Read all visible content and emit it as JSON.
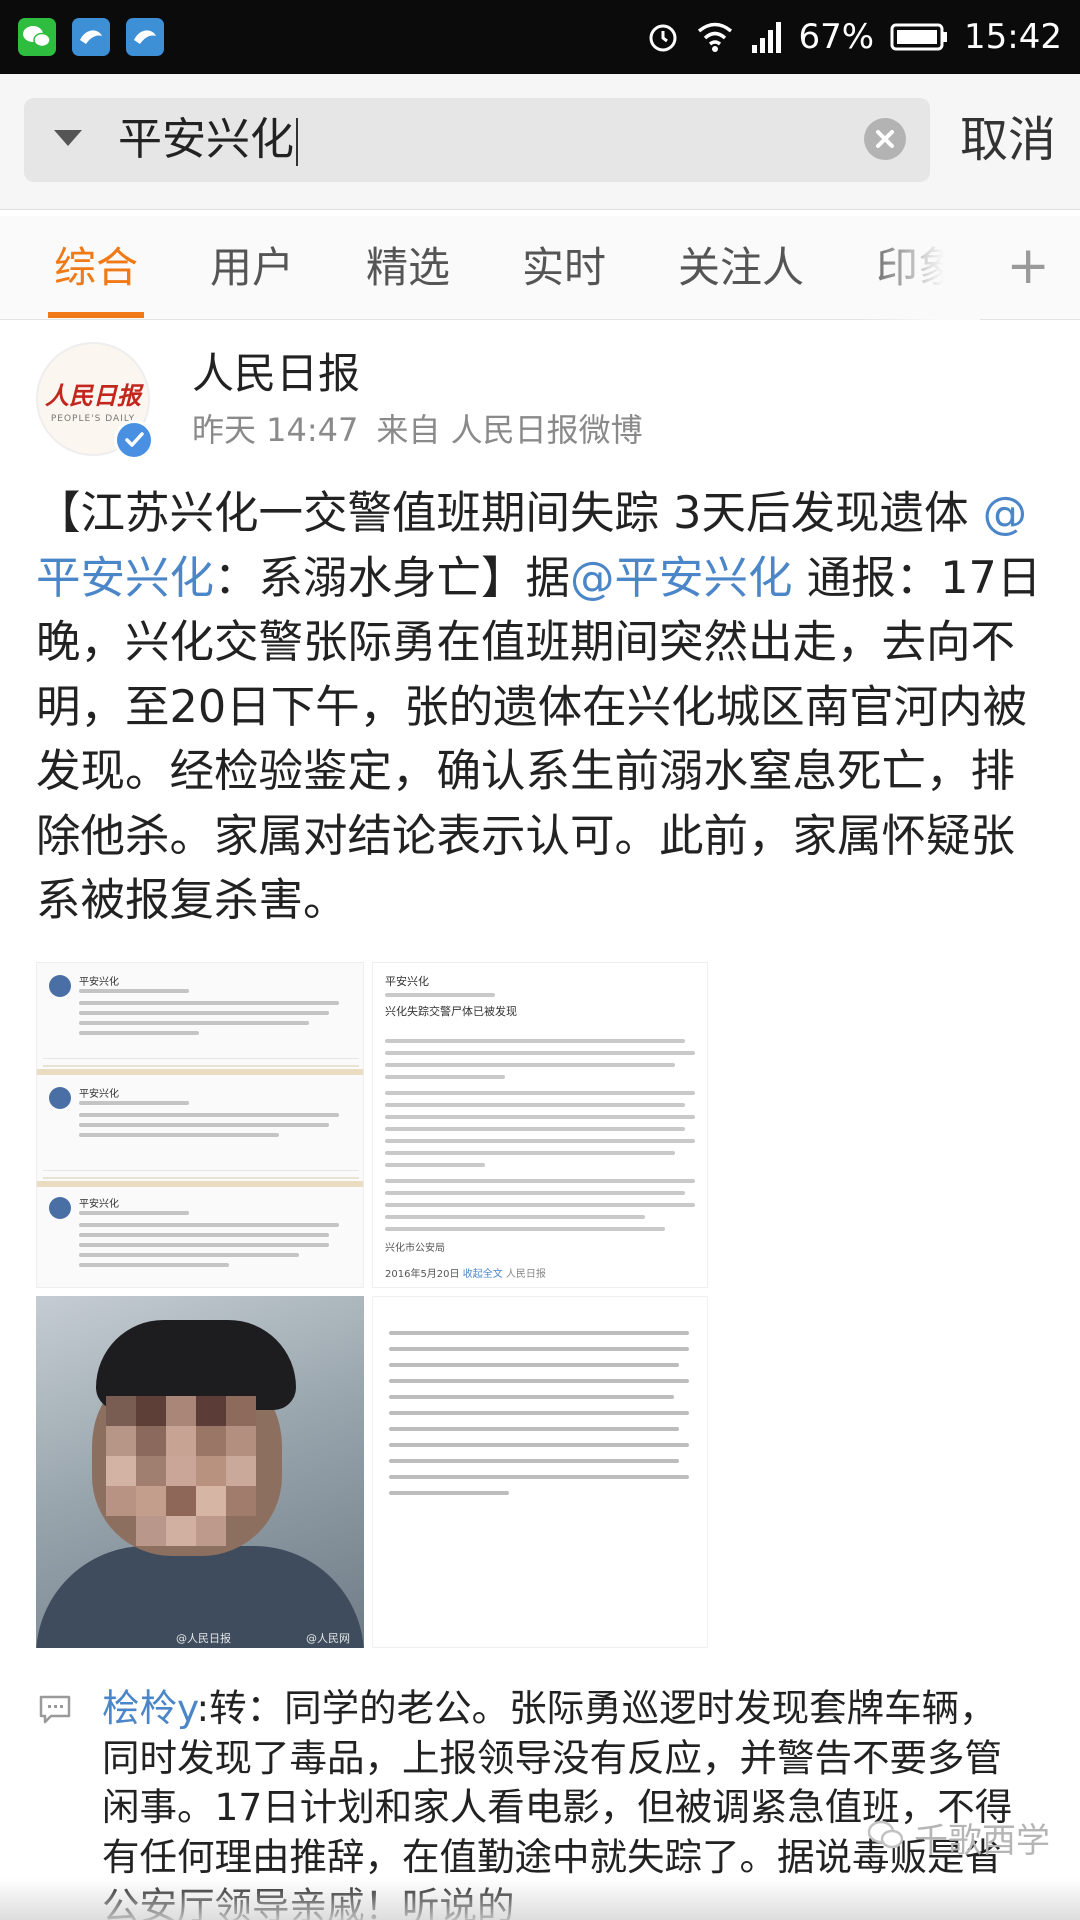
{
  "status_bar": {
    "battery": "67%",
    "time": "15:42",
    "app_icons": [
      "wechat-icon",
      "bird-icon",
      "bird-icon"
    ],
    "system_icons": [
      "alarm-icon",
      "wifi-icon",
      "signal-icon",
      "battery-icon"
    ]
  },
  "search": {
    "query": "平安兴化",
    "cancel_label": "取消"
  },
  "tabs": {
    "items": [
      "综合",
      "用户",
      "精选",
      "实时",
      "关注人",
      "印象"
    ],
    "active": "综合",
    "add_label": "+"
  },
  "post": {
    "author": "人民日报",
    "time": "昨天 14:47",
    "source": "来自 人民日报微博",
    "avatar_text": "人民日报",
    "avatar_subtext": "PEOPLE'S DAILY",
    "text_parts": {
      "part1": "【江苏兴化一交警值班期间失踪 3天后发现遗体 ",
      "mention1": "@平安兴化",
      "part2": "：系溺水身亡】据",
      "mention2": "@平安兴化",
      "part3": " 通报：17日晚，兴化交警张际勇在值班期间突然出走，去向不明，至20日下午，张的遗体在兴化城区南官河内被发现。经检验鉴定，确认系生前溺水窒息死亡，排除他杀。家属对结论表示认可。此前，家属怀疑张系被报复杀害。"
    },
    "images": {
      "a_names": [
        "平安兴化",
        "平安兴化",
        "平安兴化"
      ],
      "b_title": "平安兴化",
      "b_heading": "兴化失踪交警尸体已被发现",
      "b_sign": "兴化市公安局",
      "b_date": "2016年5月20日",
      "b_link": "收起全文",
      "watermark_b": "人民日报",
      "watermark_c1": "@人民日报",
      "watermark_c2": "@人民网"
    }
  },
  "comment": {
    "user": "桧柃y",
    "text": ":转：同学的老公。张际勇巡逻时发现套牌车辆，同时发现了毒品，上报领导没有反应，并警告不要多管闲事。17日计划和家人看电影，但被调紧急值班，不得有任何理由推辞，在值勤途中就失踪了。据说毒贩是省公安厅领导亲戚！听说的"
  },
  "brand_watermark": "千歌酉学",
  "colors": {
    "accent": "#f07a17",
    "link": "#4b86c9",
    "verified": "#4a90e2"
  }
}
